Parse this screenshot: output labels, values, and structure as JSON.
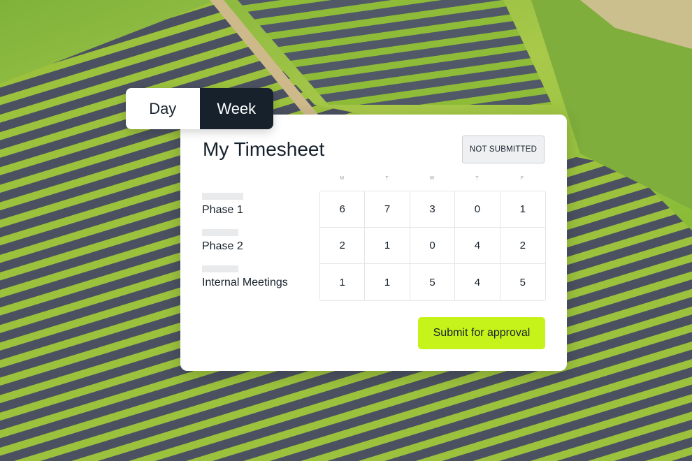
{
  "view_toggle": {
    "options": [
      {
        "label": "Day",
        "active": false
      },
      {
        "label": "Week",
        "active": true
      }
    ]
  },
  "timesheet": {
    "title": "My Timesheet",
    "status_badge": "NOT SUBMITTED",
    "day_headers": [
      "M",
      "T",
      "W",
      "T",
      "F"
    ],
    "rows": [
      {
        "label": "Phase 1",
        "hours": [
          "6",
          "7",
          "3",
          "0",
          "1"
        ]
      },
      {
        "label": "Phase 2",
        "hours": [
          "2",
          "1",
          "0",
          "4",
          "2"
        ]
      },
      {
        "label": "Internal Meetings",
        "hours": [
          "1",
          "1",
          "5",
          "4",
          "5"
        ]
      }
    ],
    "submit_label": "Submit for approval"
  },
  "colors": {
    "accent": "#c6f31a",
    "dark": "#16212c",
    "badge_bg": "#eef0f2"
  }
}
